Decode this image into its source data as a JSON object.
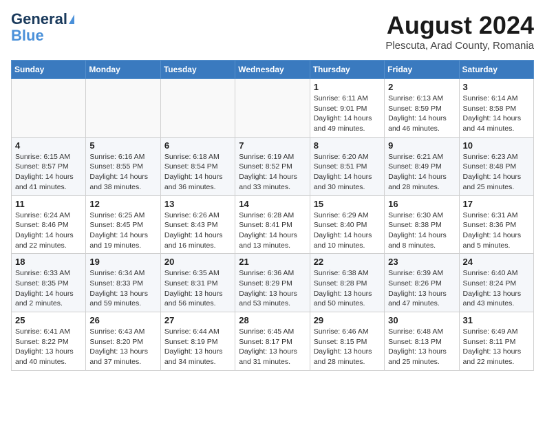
{
  "header": {
    "logo_line1": "General",
    "logo_line2": "Blue",
    "month_title": "August 2024",
    "subtitle": "Plescuta, Arad County, Romania"
  },
  "weekdays": [
    "Sunday",
    "Monday",
    "Tuesday",
    "Wednesday",
    "Thursday",
    "Friday",
    "Saturday"
  ],
  "weeks": [
    [
      {
        "day": "",
        "info": ""
      },
      {
        "day": "",
        "info": ""
      },
      {
        "day": "",
        "info": ""
      },
      {
        "day": "",
        "info": ""
      },
      {
        "day": "1",
        "info": "Sunrise: 6:11 AM\nSunset: 9:01 PM\nDaylight: 14 hours\nand 49 minutes."
      },
      {
        "day": "2",
        "info": "Sunrise: 6:13 AM\nSunset: 8:59 PM\nDaylight: 14 hours\nand 46 minutes."
      },
      {
        "day": "3",
        "info": "Sunrise: 6:14 AM\nSunset: 8:58 PM\nDaylight: 14 hours\nand 44 minutes."
      }
    ],
    [
      {
        "day": "4",
        "info": "Sunrise: 6:15 AM\nSunset: 8:57 PM\nDaylight: 14 hours\nand 41 minutes."
      },
      {
        "day": "5",
        "info": "Sunrise: 6:16 AM\nSunset: 8:55 PM\nDaylight: 14 hours\nand 38 minutes."
      },
      {
        "day": "6",
        "info": "Sunrise: 6:18 AM\nSunset: 8:54 PM\nDaylight: 14 hours\nand 36 minutes."
      },
      {
        "day": "7",
        "info": "Sunrise: 6:19 AM\nSunset: 8:52 PM\nDaylight: 14 hours\nand 33 minutes."
      },
      {
        "day": "8",
        "info": "Sunrise: 6:20 AM\nSunset: 8:51 PM\nDaylight: 14 hours\nand 30 minutes."
      },
      {
        "day": "9",
        "info": "Sunrise: 6:21 AM\nSunset: 8:49 PM\nDaylight: 14 hours\nand 28 minutes."
      },
      {
        "day": "10",
        "info": "Sunrise: 6:23 AM\nSunset: 8:48 PM\nDaylight: 14 hours\nand 25 minutes."
      }
    ],
    [
      {
        "day": "11",
        "info": "Sunrise: 6:24 AM\nSunset: 8:46 PM\nDaylight: 14 hours\nand 22 minutes."
      },
      {
        "day": "12",
        "info": "Sunrise: 6:25 AM\nSunset: 8:45 PM\nDaylight: 14 hours\nand 19 minutes."
      },
      {
        "day": "13",
        "info": "Sunrise: 6:26 AM\nSunset: 8:43 PM\nDaylight: 14 hours\nand 16 minutes."
      },
      {
        "day": "14",
        "info": "Sunrise: 6:28 AM\nSunset: 8:41 PM\nDaylight: 14 hours\nand 13 minutes."
      },
      {
        "day": "15",
        "info": "Sunrise: 6:29 AM\nSunset: 8:40 PM\nDaylight: 14 hours\nand 10 minutes."
      },
      {
        "day": "16",
        "info": "Sunrise: 6:30 AM\nSunset: 8:38 PM\nDaylight: 14 hours\nand 8 minutes."
      },
      {
        "day": "17",
        "info": "Sunrise: 6:31 AM\nSunset: 8:36 PM\nDaylight: 14 hours\nand 5 minutes."
      }
    ],
    [
      {
        "day": "18",
        "info": "Sunrise: 6:33 AM\nSunset: 8:35 PM\nDaylight: 14 hours\nand 2 minutes."
      },
      {
        "day": "19",
        "info": "Sunrise: 6:34 AM\nSunset: 8:33 PM\nDaylight: 13 hours\nand 59 minutes."
      },
      {
        "day": "20",
        "info": "Sunrise: 6:35 AM\nSunset: 8:31 PM\nDaylight: 13 hours\nand 56 minutes."
      },
      {
        "day": "21",
        "info": "Sunrise: 6:36 AM\nSunset: 8:29 PM\nDaylight: 13 hours\nand 53 minutes."
      },
      {
        "day": "22",
        "info": "Sunrise: 6:38 AM\nSunset: 8:28 PM\nDaylight: 13 hours\nand 50 minutes."
      },
      {
        "day": "23",
        "info": "Sunrise: 6:39 AM\nSunset: 8:26 PM\nDaylight: 13 hours\nand 47 minutes."
      },
      {
        "day": "24",
        "info": "Sunrise: 6:40 AM\nSunset: 8:24 PM\nDaylight: 13 hours\nand 43 minutes."
      }
    ],
    [
      {
        "day": "25",
        "info": "Sunrise: 6:41 AM\nSunset: 8:22 PM\nDaylight: 13 hours\nand 40 minutes."
      },
      {
        "day": "26",
        "info": "Sunrise: 6:43 AM\nSunset: 8:20 PM\nDaylight: 13 hours\nand 37 minutes."
      },
      {
        "day": "27",
        "info": "Sunrise: 6:44 AM\nSunset: 8:19 PM\nDaylight: 13 hours\nand 34 minutes."
      },
      {
        "day": "28",
        "info": "Sunrise: 6:45 AM\nSunset: 8:17 PM\nDaylight: 13 hours\nand 31 minutes."
      },
      {
        "day": "29",
        "info": "Sunrise: 6:46 AM\nSunset: 8:15 PM\nDaylight: 13 hours\nand 28 minutes."
      },
      {
        "day": "30",
        "info": "Sunrise: 6:48 AM\nSunset: 8:13 PM\nDaylight: 13 hours\nand 25 minutes."
      },
      {
        "day": "31",
        "info": "Sunrise: 6:49 AM\nSunset: 8:11 PM\nDaylight: 13 hours\nand 22 minutes."
      }
    ]
  ]
}
